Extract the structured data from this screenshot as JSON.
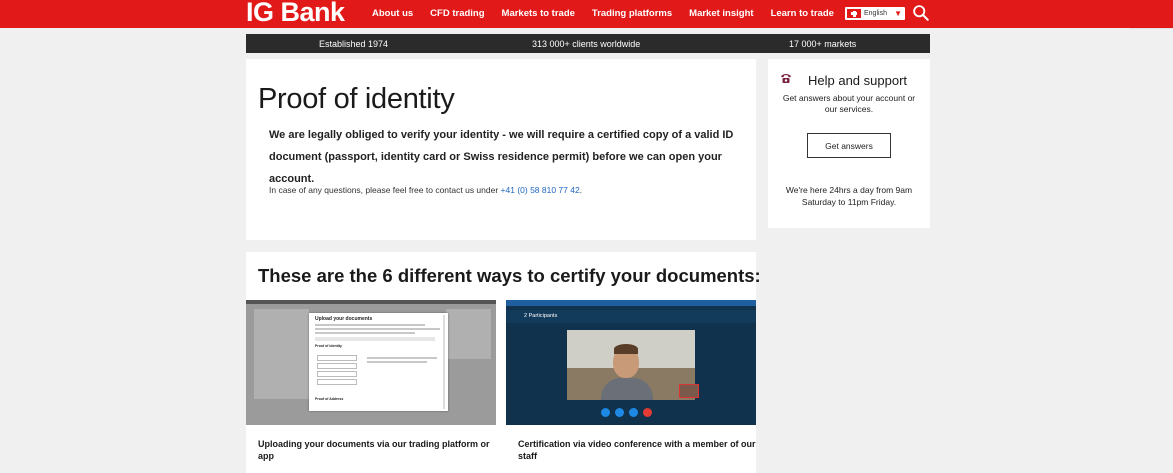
{
  "nav": {
    "logo": "IG Bank",
    "links": [
      "About us",
      "CFD trading",
      "Markets to trade",
      "Trading platforms",
      "Market insight",
      "Learn to trade"
    ],
    "language": "English"
  },
  "infobar": {
    "established": "Established 1974",
    "clients": "313 000+ clients worldwide",
    "markets": "17 000+ markets"
  },
  "main": {
    "title": "Proof of identity",
    "lead": "We are legally obliged to verify your identity - we will require a certified copy of a valid ID document (passport, identity card or Swiss residence permit) before we can open your account.",
    "contact_prefix": "In case of any questions, please feel free to contact us under ",
    "contact_phone": "+41 (0) 58 810 77 42",
    "contact_suffix": "."
  },
  "help": {
    "title": "Help and support",
    "description": "Get answers about your account or our services.",
    "button_label": "Get answers",
    "hours": "We're here 24hrs a day from 9am Saturday to 11pm Friday."
  },
  "ways": {
    "title": "These are the 6 different ways to certify your documents:",
    "items": [
      {
        "caption": "Uploading your documents via our trading platform or app",
        "modal_title": "Upload your documents",
        "modal_section_1": "Proof of identity",
        "modal_section_2": "Proof of Address"
      },
      {
        "caption": "Certification via video conference with a member of our staff",
        "participants": "2 Participants"
      }
    ]
  },
  "colors": {
    "brand_red": "#e21919",
    "infobar_bg": "#2b2b2b",
    "link_blue": "#1f66c1"
  }
}
